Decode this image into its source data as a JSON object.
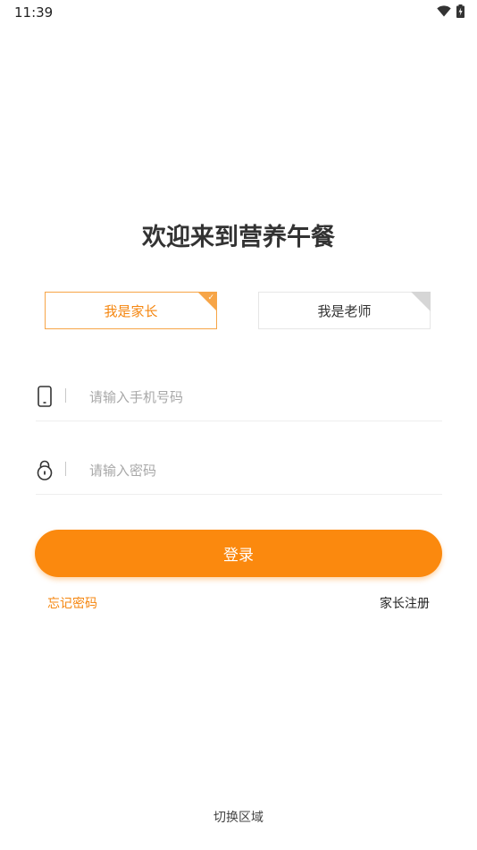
{
  "status_bar": {
    "time": "11:39"
  },
  "title": "欢迎来到营养午餐",
  "roles": {
    "parent": "我是家长",
    "teacher": "我是老师",
    "check": "✓"
  },
  "phone": {
    "placeholder": "请输入手机号码",
    "value": ""
  },
  "password": {
    "placeholder": "请输入密码",
    "value": ""
  },
  "login": "登录",
  "links": {
    "forgot": "忘记密码",
    "register": "家长注册"
  },
  "switch_region": "切换区域",
  "colors": {
    "accent": "#fb890e",
    "accent_border": "#f7a547",
    "inactive_corner": "#d6d6d6"
  }
}
